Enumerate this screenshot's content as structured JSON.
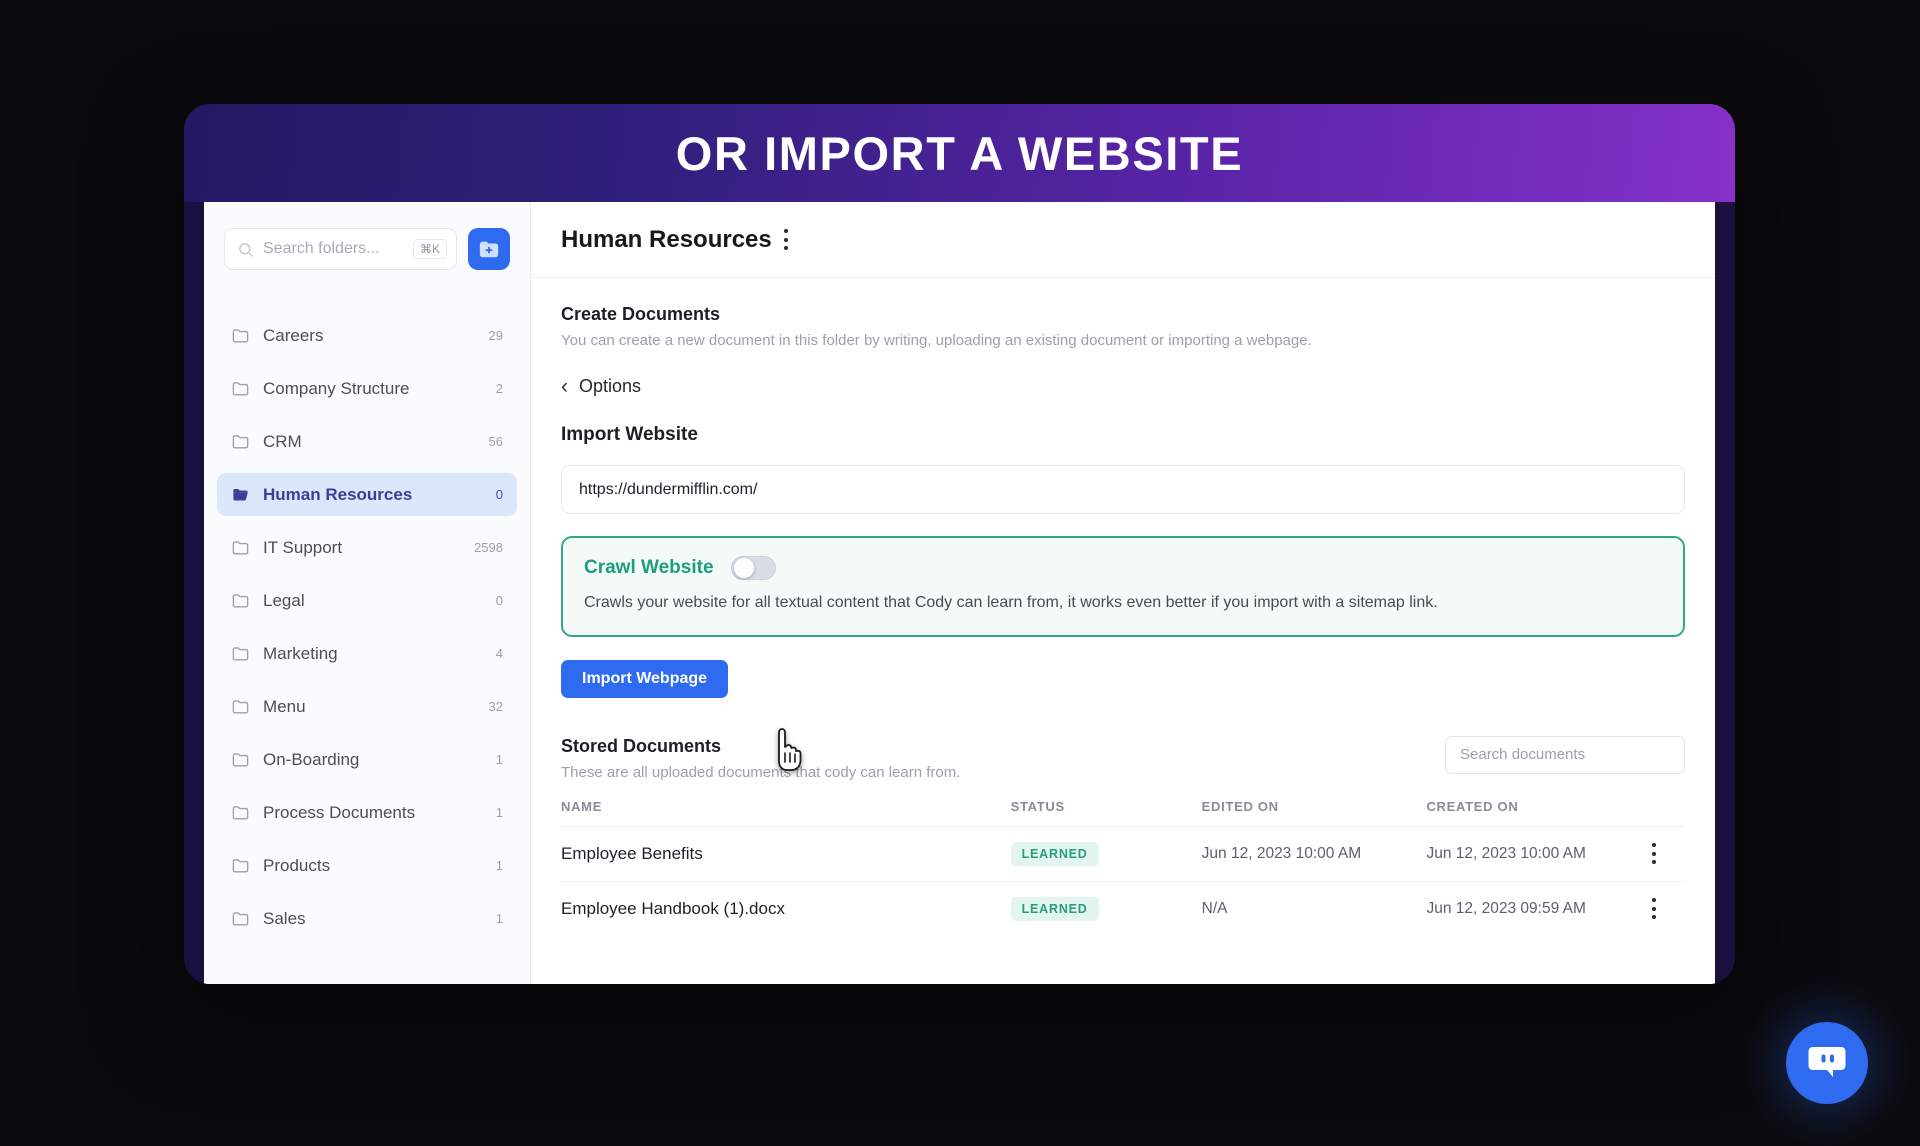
{
  "banner": {
    "title": "OR IMPORT A WEBSITE"
  },
  "sidebar": {
    "search": {
      "placeholder": "Search folders...",
      "shortcut": "⌘K"
    },
    "add_folder_label": "add-folder",
    "folders": [
      {
        "label": "Careers",
        "count": "29",
        "active": false
      },
      {
        "label": "Company Structure",
        "count": "2",
        "active": false
      },
      {
        "label": "CRM",
        "count": "56",
        "active": false
      },
      {
        "label": "Human Resources",
        "count": "0",
        "active": true
      },
      {
        "label": "IT Support",
        "count": "2598",
        "active": false
      },
      {
        "label": "Legal",
        "count": "0",
        "active": false
      },
      {
        "label": "Marketing",
        "count": "4",
        "active": false
      },
      {
        "label": "Menu",
        "count": "32",
        "active": false
      },
      {
        "label": "On-Boarding",
        "count": "1",
        "active": false
      },
      {
        "label": "Process Documents",
        "count": "1",
        "active": false
      },
      {
        "label": "Products",
        "count": "1",
        "active": false
      },
      {
        "label": "Sales",
        "count": "1",
        "active": false
      }
    ]
  },
  "main": {
    "title": "Human Resources",
    "create": {
      "heading": "Create Documents",
      "subtext": "You can create a new document in this folder by writing, uploading an existing document or importing a webpage."
    },
    "options_label": "Options",
    "import": {
      "heading": "Import Website",
      "url_value": "https://dundermifflin.com/",
      "button_label": "Import Webpage"
    },
    "crawl": {
      "title": "Crawl Website",
      "toggle_state": "off",
      "description": "Crawls your website for all textual content that Cody can learn from, it works even better if you import with a sitemap link."
    },
    "stored": {
      "heading": "Stored Documents",
      "subtext": "These are all uploaded documents that cody can learn from.",
      "search_placeholder": "Search documents",
      "columns": [
        "NAME",
        "STATUS",
        "EDITED ON",
        "CREATED ON"
      ],
      "rows": [
        {
          "name": "Employee Benefits",
          "status": "LEARNED",
          "edited_on": "Jun 12, 2023 10:00 AM",
          "created_on": "Jun 12, 2023 10:00 AM"
        },
        {
          "name": "Employee Handbook (1).docx",
          "status": "LEARNED",
          "edited_on": "N/A",
          "created_on": "Jun 12, 2023 09:59 AM"
        }
      ]
    }
  },
  "chat_fab": {
    "label": "chat-bot"
  },
  "colors": {
    "accent_blue": "#2f6bf0",
    "crawl_green": "#2fa88a",
    "banner_start": "#241a63",
    "banner_end": "#8631c9",
    "active_item_bg": "#dbe7fb"
  }
}
